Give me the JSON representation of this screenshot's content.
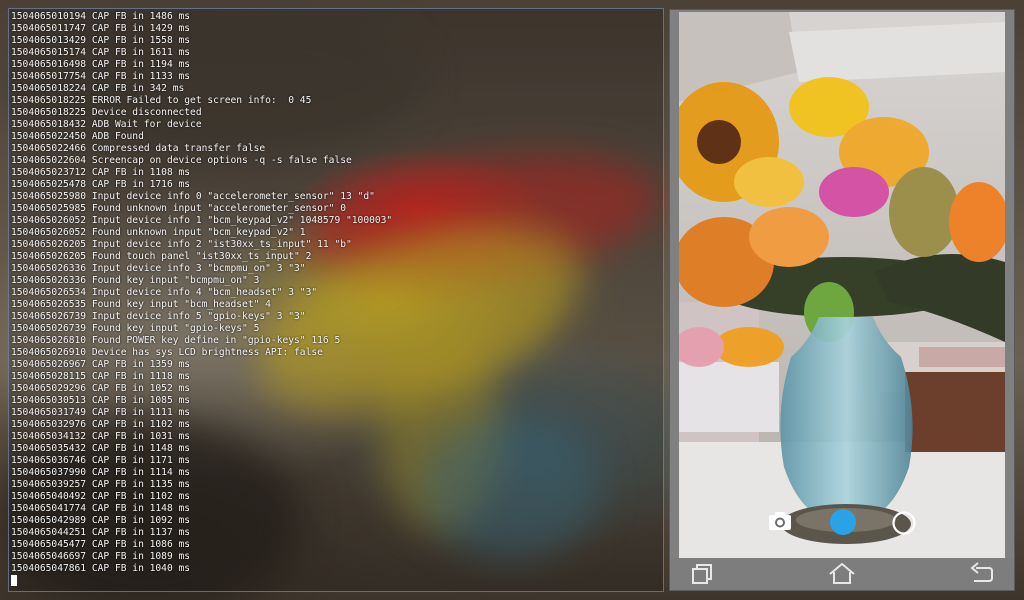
{
  "console": {
    "lines": [
      "1504065010194 CAP FB in 1486 ms",
      "1504065011747 CAP FB in 1429 ms",
      "1504065013429 CAP FB in 1558 ms",
      "1504065015174 CAP FB in 1611 ms",
      "1504065016498 CAP FB in 1194 ms",
      "1504065017754 CAP FB in 1133 ms",
      "1504065018224 CAP FB in 342 ms",
      "1504065018225 ERROR Failed to get screen info:  0 45",
      "1504065018225 Device disconnected",
      "1504065018432 ADB Wait for device",
      "1504065022450 ADB Found",
      "1504065022466 Compressed data transfer false",
      "1504065022604 Screencap on device options -q -s false false",
      "1504065023712 CAP FB in 1108 ms",
      "1504065025478 CAP FB in 1716 ms",
      "1504065025980 Input device info 0 \"accelerometer_sensor\" 13 \"d\"",
      "1504065025985 Found unknown input \"accelerometer_sensor\" 0",
      "1504065026052 Input device info 1 \"bcm_keypad_v2\" 1048579 \"100003\"",
      "1504065026052 Found unknown input \"bcm_keypad_v2\" 1",
      "1504065026205 Input device info 2 \"ist30xx_ts_input\" 11 \"b\"",
      "1504065026205 Found touch panel \"ist30xx_ts_input\" 2",
      "1504065026336 Input device info 3 \"bcmpmu_on\" 3 \"3\"",
      "1504065026336 Found key input \"bcmpmu_on\" 3",
      "1504065026534 Input device info 4 \"bcm_headset\" 3 \"3\"",
      "1504065026535 Found key input \"bcm_headset\" 4",
      "1504065026739 Input device info 5 \"gpio-keys\" 3 \"3\"",
      "1504065026739 Found key input \"gpio-keys\" 5",
      "1504065026810 Found POWER key define in \"gpio-keys\" 116 5",
      "1504065026910 Device has sys LCD brightness API: false",
      "1504065026967 CAP FB in 1359 ms",
      "1504065028115 CAP FB in 1118 ms",
      "1504065029296 CAP FB in 1052 ms",
      "1504065030513 CAP FB in 1085 ms",
      "1504065031749 CAP FB in 1111 ms",
      "1504065032976 CAP FB in 1102 ms",
      "1504065034132 CAP FB in 1031 ms",
      "1504065035432 CAP FB in 1148 ms",
      "1504065036746 CAP FB in 1171 ms",
      "1504065037990 CAP FB in 1114 ms",
      "1504065039257 CAP FB in 1135 ms",
      "1504065040492 CAP FB in 1102 ms",
      "1504065041774 CAP FB in 1148 ms",
      "1504065042989 CAP FB in 1092 ms",
      "1504065044251 CAP FB in 1137 ms",
      "1504065045477 CAP FB in 1086 ms",
      "1504065046697 CAP FB in 1089 ms",
      "1504065047861 CAP FB in 1040 ms"
    ]
  },
  "phone": {
    "camera_controls": {
      "mode_icon": "camera-icon",
      "shutter_icon": "shutter-button",
      "switch_icon": "circle-mode-icon",
      "shutter_color": "#29a3e6"
    },
    "navbar": {
      "recent_icon": "recent-apps-icon",
      "home_icon": "home-icon",
      "back_icon": "back-icon"
    }
  },
  "colors": {
    "console_text": "#f4f4f4",
    "panel_border": "#7888aa",
    "navbar_bg": "#7d7d7d"
  }
}
